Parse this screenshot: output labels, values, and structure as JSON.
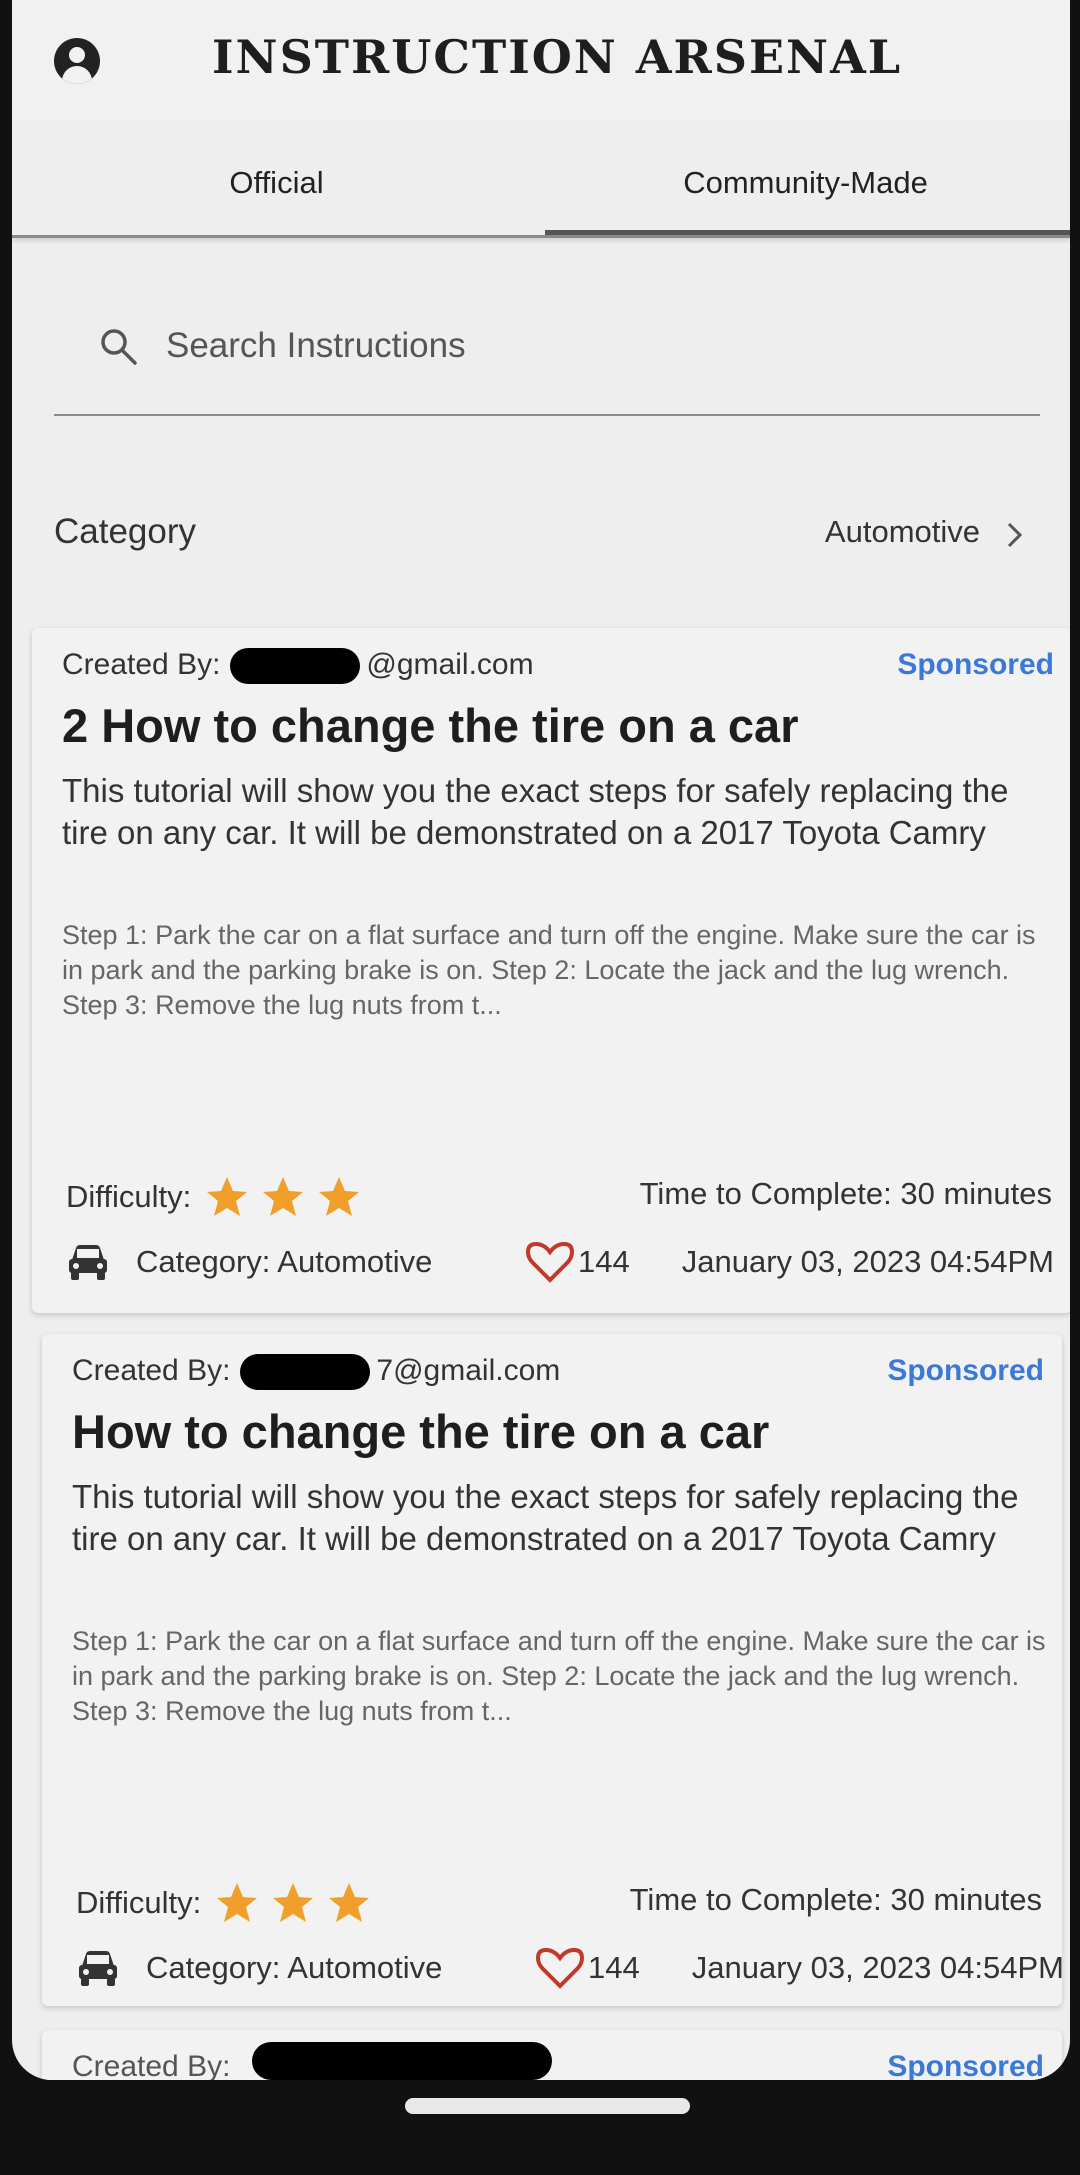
{
  "app": {
    "title": "INSTRUCTION ARSENAL"
  },
  "tabs": [
    {
      "label": "Official",
      "selected": false
    },
    {
      "label": "Community-Made",
      "selected": true
    }
  ],
  "search": {
    "placeholder": "Search Instructions"
  },
  "category": {
    "label": "Category",
    "value": "Automotive"
  },
  "cards": [
    {
      "created_by_prefix": "Created By:",
      "created_by_email_suffix": "@gmail.com",
      "sponsored": "Sponsored",
      "title": "2 How to change the tire on a car",
      "description": "This tutorial will show you the exact steps for safely replacing the tire on any car. It will be demonstrated on a 2017 Toyota Camry",
      "steps_preview": "Step 1: Park the car on a flat surface and turn off the engine. Make sure the car is in park and the parking brake is on. Step 2: Locate the jack and the lug wrench. Step 3: Remove the lug nuts from t...",
      "difficulty_label": "Difficulty:",
      "difficulty_stars": 3,
      "time": "Time to Complete: 30 minutes",
      "category": "Category: Automotive",
      "likes": "144",
      "date": "January 03, 2023 04:54PM"
    },
    {
      "created_by_prefix": "Created By:",
      "created_by_email_suffix": "7@gmail.com",
      "sponsored": "Sponsored",
      "title": "How to change the tire on a car",
      "description": "This tutorial will show you the exact steps for safely replacing the tire on any car. It will be demonstrated on a 2017 Toyota Camry",
      "steps_preview": "Step 1: Park the car on a flat surface and turn off the engine. Make sure the car is in park and the parking brake is on. Step 2: Locate the jack and the lug wrench. Step 3: Remove the lug nuts from t...",
      "difficulty_label": "Difficulty:",
      "difficulty_stars": 3,
      "time": "Time to Complete: 30 minutes",
      "category": "Category: Automotive",
      "likes": "144",
      "date": "January 03, 2023 04:54PM"
    },
    {
      "created_by_prefix": "Created By:",
      "sponsored": "Sponsored"
    }
  ],
  "colors": {
    "sponsored": "#3b78d8",
    "star": "#f0a02a",
    "heart": "#c0392b"
  }
}
